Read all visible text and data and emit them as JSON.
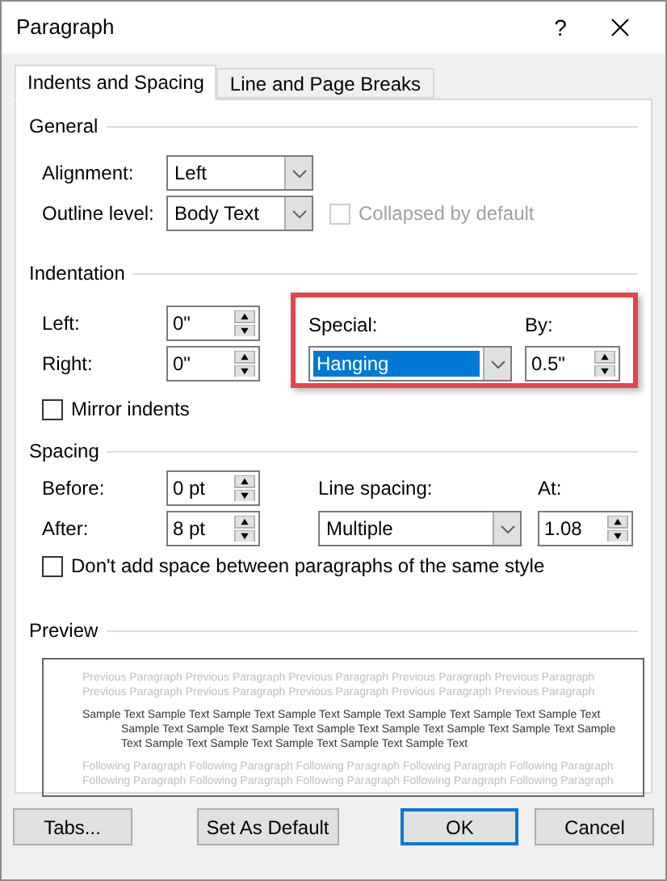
{
  "window": {
    "title": "Paragraph",
    "help": "?"
  },
  "tabs": [
    {
      "label": "Indents and Spacing",
      "selected": true
    },
    {
      "label": "Line and Page Breaks",
      "selected": false
    }
  ],
  "general": {
    "title": "General",
    "alignment": {
      "label": "Alignment:",
      "value": "Left"
    },
    "outline_level": {
      "label": "Outline level:",
      "value": "Body Text"
    },
    "collapsed": {
      "label": "Collapsed by default",
      "checked": false,
      "disabled": true
    }
  },
  "indentation": {
    "title": "Indentation",
    "left": {
      "label": "Left:",
      "value": "0\""
    },
    "right": {
      "label": "Right:",
      "value": "0\""
    },
    "special": {
      "label": "Special:",
      "value": "Hanging",
      "selected": true
    },
    "by": {
      "label": "By:",
      "value": "0.5\""
    },
    "mirror": {
      "label": "Mirror indents",
      "checked": false
    }
  },
  "spacing": {
    "title": "Spacing",
    "before": {
      "label": "Before:",
      "value": "0 pt"
    },
    "after": {
      "label": "After:",
      "value": "8 pt"
    },
    "line_spacing": {
      "label": "Line spacing:",
      "value": "Multiple"
    },
    "at": {
      "label": "At:",
      "value": "1.08"
    },
    "dont_add": {
      "label": "Don't add space between paragraphs of the same style",
      "checked": false
    }
  },
  "preview": {
    "title": "Preview",
    "previous": [
      "Previous Paragraph Previous Paragraph Previous Paragraph Previous Paragraph Previous Paragraph",
      "Previous Paragraph Previous Paragraph Previous Paragraph Previous Paragraph Previous Paragraph"
    ],
    "sample": [
      "Sample Text Sample Text Sample Text Sample Text Sample Text Sample Text Sample Text Sample Text",
      "Sample Text Sample Text Sample Text Sample Text Sample Text Sample Text Sample Text Sample",
      "Text Sample Text Sample Text Sample Text Sample Text Sample Text"
    ],
    "following": [
      "Following Paragraph Following Paragraph Following Paragraph Following Paragraph Following Paragraph",
      "Following Paragraph Following Paragraph Following Paragraph Following Paragraph Following Paragraph"
    ]
  },
  "buttons": [
    {
      "label": "Tabs...",
      "default": false
    },
    {
      "label": "Set As Default",
      "default": false
    },
    {
      "label": "OK",
      "default": true
    },
    {
      "label": "Cancel",
      "default": false
    }
  ]
}
